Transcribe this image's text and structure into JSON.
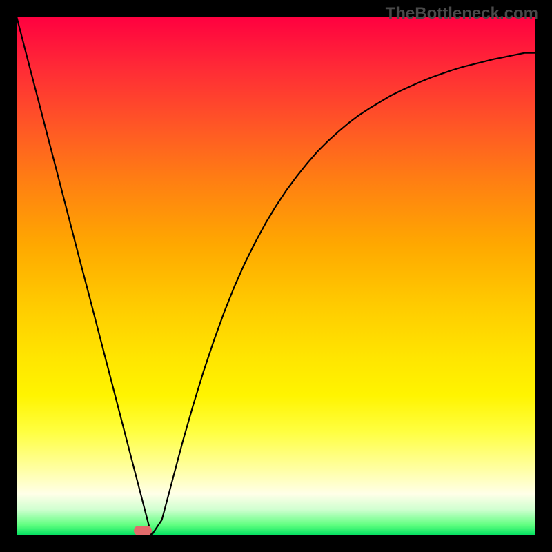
{
  "watermark": "TheBottleneck.com",
  "chart_data": {
    "type": "line",
    "title": "",
    "xlabel": "",
    "ylabel": "",
    "xlim": [
      0,
      100
    ],
    "ylim": [
      0,
      100
    ],
    "x": [
      0,
      2,
      4,
      6,
      8,
      10,
      12,
      14,
      16,
      18,
      20,
      22,
      24,
      26,
      28,
      30,
      32,
      34,
      36,
      38,
      40,
      42,
      44,
      46,
      48,
      50,
      52,
      54,
      56,
      58,
      60,
      62,
      64,
      66,
      68,
      70,
      72,
      74,
      76,
      78,
      80,
      82,
      84,
      86,
      88,
      90,
      92,
      94,
      96,
      98,
      100
    ],
    "values": [
      100,
      92.3,
      84.6,
      76.9,
      69.2,
      61.5,
      53.8,
      46.2,
      38.5,
      30.8,
      23.1,
      15.4,
      7.7,
      0,
      3.0,
      10.5,
      18.0,
      25.0,
      31.5,
      37.5,
      43.0,
      48.0,
      52.5,
      56.5,
      60.2,
      63.5,
      66.5,
      69.2,
      71.7,
      74.0,
      76.0,
      77.8,
      79.5,
      81.0,
      82.3,
      83.5,
      84.7,
      85.7,
      86.6,
      87.5,
      88.3,
      89.0,
      89.7,
      90.3,
      90.8,
      91.3,
      91.8,
      92.2,
      92.6,
      93.0,
      93.0
    ],
    "series": [
      {
        "name": "bottleneck-curve",
        "values": [
          100,
          92.3,
          84.6,
          76.9,
          69.2,
          61.5,
          53.8,
          46.2,
          38.5,
          30.8,
          23.1,
          15.4,
          7.7,
          0,
          3.0,
          10.5,
          18.0,
          25.0,
          31.5,
          37.5,
          43.0,
          48.0,
          52.5,
          56.5,
          60.2,
          63.5,
          66.5,
          69.2,
          71.7,
          74.0,
          76.0,
          77.8,
          79.5,
          81.0,
          82.3,
          83.5,
          84.7,
          85.7,
          86.6,
          87.5,
          88.3,
          89.0,
          89.7,
          90.3,
          90.8,
          91.3,
          91.8,
          92.2,
          92.6,
          93.0,
          93.0
        ]
      }
    ],
    "marker": {
      "x": 26,
      "y": 0,
      "color": "#e26b6b"
    },
    "gradient_stops": [
      {
        "pos": 0,
        "color": "#ff0040"
      },
      {
        "pos": 0.5,
        "color": "#ffcc00"
      },
      {
        "pos": 0.8,
        "color": "#ffff60"
      },
      {
        "pos": 1.0,
        "color": "#00e060"
      }
    ]
  }
}
